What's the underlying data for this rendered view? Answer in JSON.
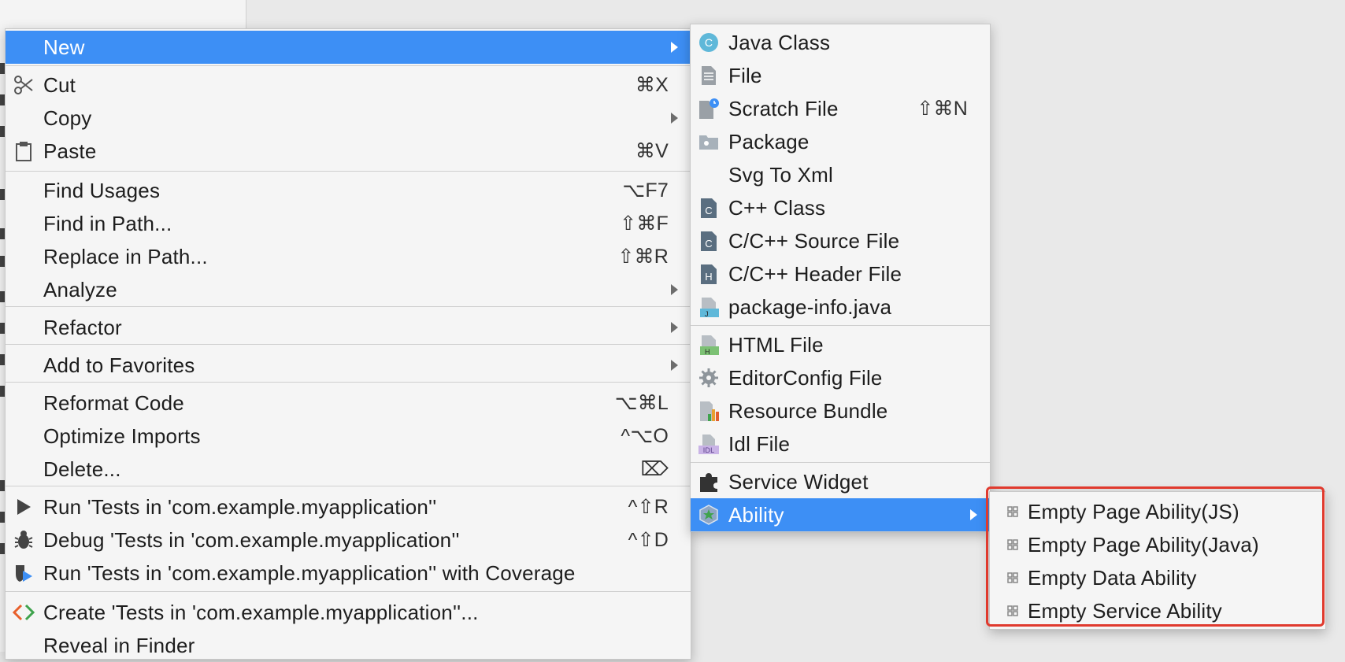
{
  "main_menu": {
    "items": [
      {
        "label": "New",
        "shortcut": "",
        "has_submenu": true,
        "selected": true,
        "icon": ""
      },
      {
        "label": "Cut",
        "shortcut": "⌘X",
        "icon": "scissors-icon"
      },
      {
        "label": "Copy",
        "shortcut": "",
        "has_submenu": true,
        "icon": ""
      },
      {
        "label": "Paste",
        "shortcut": "⌘V",
        "icon": "clipboard-icon"
      },
      {
        "label": "Find Usages",
        "shortcut": "⌥F7"
      },
      {
        "label": "Find in Path...",
        "shortcut": "⇧⌘F"
      },
      {
        "label": "Replace in Path...",
        "shortcut": "⇧⌘R"
      },
      {
        "label": "Analyze",
        "shortcut": "",
        "has_submenu": true
      },
      {
        "label": "Refactor",
        "shortcut": "",
        "has_submenu": true
      },
      {
        "label": "Add to Favorites",
        "shortcut": "",
        "has_submenu": true
      },
      {
        "label": "Reformat Code",
        "shortcut": "⌥⌘L"
      },
      {
        "label": "Optimize Imports",
        "shortcut": "^⌥O"
      },
      {
        "label": "Delete...",
        "shortcut": "⌦"
      },
      {
        "label": "Run 'Tests in 'com.example.myapplication''",
        "shortcut": "^⇧R",
        "icon": "run-icon"
      },
      {
        "label": "Debug 'Tests in 'com.example.myapplication''",
        "shortcut": "^⇧D",
        "icon": "debug-icon"
      },
      {
        "label": "Run 'Tests in 'com.example.myapplication'' with Coverage",
        "shortcut": "",
        "icon": "coverage-icon"
      },
      {
        "label": "Create 'Tests in 'com.example.myapplication''...",
        "shortcut": "",
        "icon": "create-test-icon"
      },
      {
        "label": "Reveal in Finder",
        "shortcut": ""
      }
    ]
  },
  "new_submenu": {
    "items": [
      {
        "label": "Java Class",
        "shortcut": "",
        "icon": "java-class-icon"
      },
      {
        "label": "File",
        "shortcut": "",
        "icon": "file-icon"
      },
      {
        "label": "Scratch File",
        "shortcut": "⇧⌘N",
        "icon": "scratch-file-icon"
      },
      {
        "label": "Package",
        "shortcut": "",
        "icon": "package-folder-icon"
      },
      {
        "label": "Svg To Xml",
        "shortcut": "",
        "icon": ""
      },
      {
        "label": "C++ Class",
        "shortcut": "",
        "icon": "cpp-class-icon"
      },
      {
        "label": "C/C++ Source File",
        "shortcut": "",
        "icon": "c-source-file-icon"
      },
      {
        "label": "C/C++ Header File",
        "shortcut": "",
        "icon": "c-header-file-icon"
      },
      {
        "label": "package-info.java",
        "shortcut": "",
        "icon": "package-info-icon"
      },
      {
        "label": "HTML File",
        "shortcut": "",
        "icon": "html-file-icon"
      },
      {
        "label": "EditorConfig File",
        "shortcut": "",
        "icon": "gear-icon"
      },
      {
        "label": "Resource Bundle",
        "shortcut": "",
        "icon": "resource-bundle-icon"
      },
      {
        "label": "Idl File",
        "shortcut": "",
        "icon": "idl-file-icon"
      },
      {
        "label": "Service Widget",
        "shortcut": "",
        "icon": "puzzle-icon"
      },
      {
        "label": "Ability",
        "shortcut": "",
        "has_submenu": true,
        "selected": true,
        "icon": "ability-icon"
      }
    ]
  },
  "ability_submenu": {
    "items": [
      {
        "label": "Empty Page Ability(JS)",
        "icon": "template-icon"
      },
      {
        "label": "Empty Page Ability(Java)",
        "icon": "template-icon"
      },
      {
        "label": "Empty Data Ability",
        "icon": "template-icon"
      },
      {
        "label": "Empty Service Ability",
        "icon": "template-icon"
      }
    ]
  },
  "colors": {
    "selection": "#3d8ff5",
    "highlight_frame": "#e03a2e",
    "menu_bg": "#f5f5f5"
  }
}
